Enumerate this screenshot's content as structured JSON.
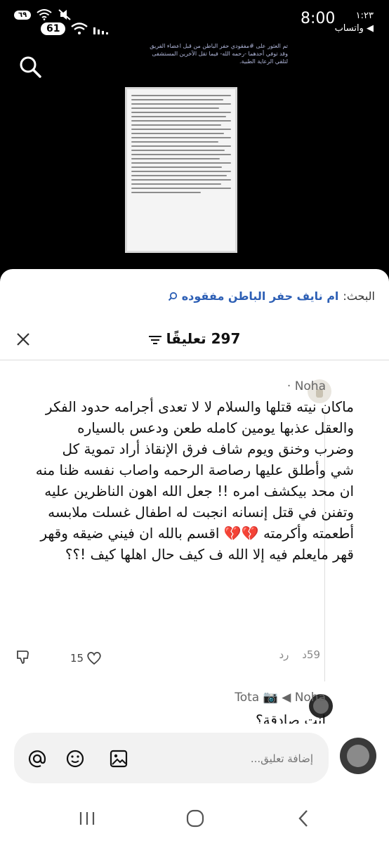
{
  "status_bar": {
    "time_small": "١:٢٣",
    "app_back": "◀ واتساب",
    "clock": "8:00",
    "notif_count": "٦٩",
    "battery": "61"
  },
  "background_post": {
    "caption": "تم العثور على #مفقودي حفر الباطن من قبل اعضاء الفريق وقد توفي أحدهما -رحمه الله- فيما تقل الآخرين المستشفى لتلقي الرعاية الطبية."
  },
  "search": {
    "label": "البحث:",
    "query": "ام نايف حفر الباطن مفقوده"
  },
  "comments_header": {
    "count": "297",
    "label": "تعليقًا"
  },
  "comment": {
    "author": "Noha",
    "text": "ماكان نيته قتلها والسلام لا لا تعدى أجرامه حدود الفكر والعقل عذبها يومين كامله طعن ودعس بالسياره وضرب وخنق ويوم شاف فرق الإنقاذ أراد تموية كل شي وأطلق عليها رصاصة الرحمه واصاب نفسه ظنا منه ان محد بيكشف امره !! جعل الله اهون الناظرين عليه وتفنن في قتل إنسانه انجبت له اطفال غسلت ملابسه أطعمته وأكرمته 💔💔 اقسم بالله ان فيني ضيقه وقهر قهر مايعلم فيه إلا الله ف كيف حال اهلها كيف !؟؟",
    "time": "59د",
    "reply_label": "رد",
    "likes": "15"
  },
  "reply": {
    "author": "Tota",
    "to": "Noha",
    "text": "انت صادقة؟"
  },
  "composer": {
    "placeholder": "إضافة تعليق..."
  },
  "colors": {
    "accent": "#2d5fb5",
    "sheet_bg": "#ffffff",
    "input_bg": "#f2f2f2"
  }
}
